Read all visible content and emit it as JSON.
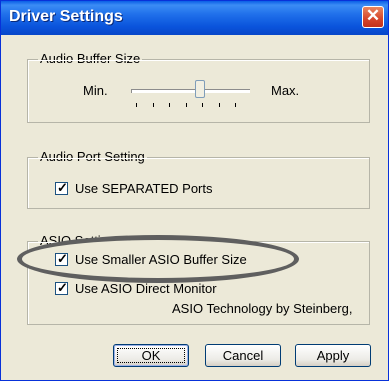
{
  "window": {
    "title": "Driver Settings",
    "close_glyph": "✕"
  },
  "buffer_group": {
    "legend": "Audio Buffer Size",
    "min_label": "Min.",
    "max_label": "Max.",
    "slider_position": 0.5
  },
  "port_group": {
    "legend": "Audio Port Setting",
    "checkbox_label": "Use SEPARATED Ports",
    "checked": true
  },
  "asio_group": {
    "legend": "ASIO Setting",
    "smaller_buffer_label": "Use Smaller ASIO Buffer Size",
    "smaller_buffer_checked": true,
    "direct_monitor_label": "Use ASIO Direct Monitor",
    "direct_monitor_checked": true,
    "credit": "ASIO Technology by Steinberg,"
  },
  "buttons": {
    "ok": "OK",
    "cancel": "Cancel",
    "apply": "Apply"
  },
  "check_glyph": "✓"
}
